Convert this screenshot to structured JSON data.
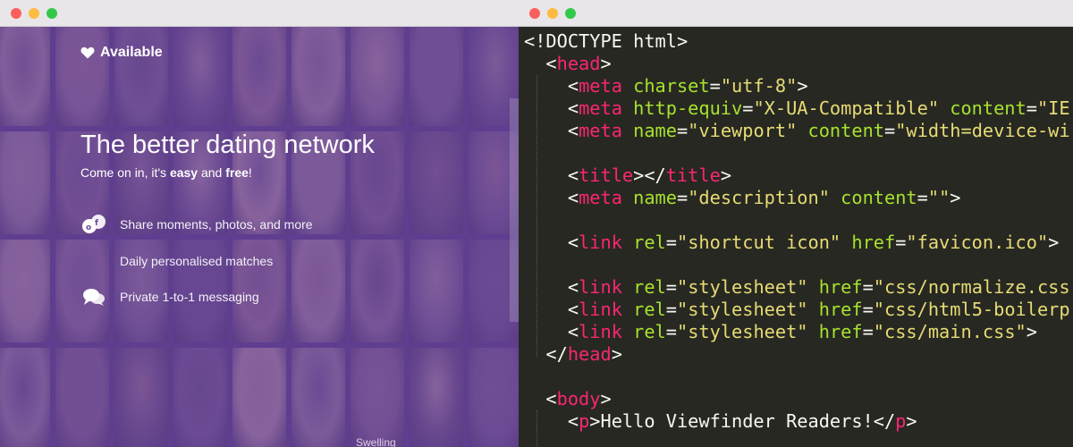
{
  "left_window": {
    "site": {
      "logo_text": "Available",
      "headline": "The better dating network",
      "tagline": {
        "part1": "Come on in, it's ",
        "easy": "easy",
        "and": " and ",
        "free": "free",
        "end": "!"
      },
      "features": [
        {
          "icon": "share-icon",
          "text": "Share moments, photos, and more"
        },
        {
          "icon": "",
          "text": "Daily personalised matches"
        },
        {
          "icon": "chat-icon",
          "text": "Private 1-to-1 messaging"
        }
      ],
      "bottom_text": "Swelling"
    },
    "overlay_color": "#623e96"
  },
  "right_window": {
    "code_lines": [
      [
        [
          "punc",
          "<!DOCTYPE html>"
        ]
      ],
      [
        [
          "punc",
          "  <"
        ],
        [
          "tag",
          "head"
        ],
        [
          "punc",
          ">"
        ]
      ],
      [
        [
          "punc",
          "    <"
        ],
        [
          "tag",
          "meta"
        ],
        [
          "punc",
          " "
        ],
        [
          "attr",
          "charset"
        ],
        [
          "punc",
          "="
        ],
        [
          "str",
          "\"utf-8\""
        ],
        [
          "punc",
          ">"
        ]
      ],
      [
        [
          "punc",
          "    <"
        ],
        [
          "tag",
          "meta"
        ],
        [
          "punc",
          " "
        ],
        [
          "attr",
          "http-equiv"
        ],
        [
          "punc",
          "="
        ],
        [
          "str",
          "\"X-UA-Compatible\""
        ],
        [
          "punc",
          " "
        ],
        [
          "attr",
          "content"
        ],
        [
          "punc",
          "="
        ],
        [
          "str",
          "\"IE"
        ]
      ],
      [
        [
          "punc",
          "    <"
        ],
        [
          "tag",
          "meta"
        ],
        [
          "punc",
          " "
        ],
        [
          "attr",
          "name"
        ],
        [
          "punc",
          "="
        ],
        [
          "str",
          "\"viewport\""
        ],
        [
          "punc",
          " "
        ],
        [
          "attr",
          "content"
        ],
        [
          "punc",
          "="
        ],
        [
          "str",
          "\"width=device-wi"
        ]
      ],
      [],
      [
        [
          "punc",
          "    <"
        ],
        [
          "tag",
          "title"
        ],
        [
          "punc",
          "></"
        ],
        [
          "tag",
          "title"
        ],
        [
          "punc",
          ">"
        ]
      ],
      [
        [
          "punc",
          "    <"
        ],
        [
          "tag",
          "meta"
        ],
        [
          "punc",
          " "
        ],
        [
          "attr",
          "name"
        ],
        [
          "punc",
          "="
        ],
        [
          "str",
          "\"description\""
        ],
        [
          "punc",
          " "
        ],
        [
          "attr",
          "content"
        ],
        [
          "punc",
          "="
        ],
        [
          "str",
          "\"\""
        ],
        [
          "punc",
          ">"
        ]
      ],
      [],
      [
        [
          "punc",
          "    <"
        ],
        [
          "tag",
          "link"
        ],
        [
          "punc",
          " "
        ],
        [
          "attr",
          "rel"
        ],
        [
          "punc",
          "="
        ],
        [
          "str",
          "\"shortcut icon\""
        ],
        [
          "punc",
          " "
        ],
        [
          "attr",
          "href"
        ],
        [
          "punc",
          "="
        ],
        [
          "str",
          "\"favicon.ico\""
        ],
        [
          "punc",
          ">"
        ]
      ],
      [],
      [
        [
          "punc",
          "    <"
        ],
        [
          "tag",
          "link"
        ],
        [
          "punc",
          " "
        ],
        [
          "attr",
          "rel"
        ],
        [
          "punc",
          "="
        ],
        [
          "str",
          "\"stylesheet\""
        ],
        [
          "punc",
          " "
        ],
        [
          "attr",
          "href"
        ],
        [
          "punc",
          "="
        ],
        [
          "str",
          "\"css/normalize.css"
        ]
      ],
      [
        [
          "punc",
          "    <"
        ],
        [
          "tag",
          "link"
        ],
        [
          "punc",
          " "
        ],
        [
          "attr",
          "rel"
        ],
        [
          "punc",
          "="
        ],
        [
          "str",
          "\"stylesheet\""
        ],
        [
          "punc",
          " "
        ],
        [
          "attr",
          "href"
        ],
        [
          "punc",
          "="
        ],
        [
          "str",
          "\"css/html5-boilerp"
        ]
      ],
      [
        [
          "punc",
          "    <"
        ],
        [
          "tag",
          "link"
        ],
        [
          "punc",
          " "
        ],
        [
          "attr",
          "rel"
        ],
        [
          "punc",
          "="
        ],
        [
          "str",
          "\"stylesheet\""
        ],
        [
          "punc",
          " "
        ],
        [
          "attr",
          "href"
        ],
        [
          "punc",
          "="
        ],
        [
          "str",
          "\"css/main.css\""
        ],
        [
          "punc",
          ">"
        ]
      ],
      [
        [
          "punc",
          "  </"
        ],
        [
          "tag",
          "head"
        ],
        [
          "punc",
          ">"
        ]
      ],
      [],
      [
        [
          "punc",
          "  <"
        ],
        [
          "tag",
          "body"
        ],
        [
          "punc",
          ">"
        ]
      ],
      [
        [
          "punc",
          "    <"
        ],
        [
          "tag",
          "p"
        ],
        [
          "punc",
          ">Hello Viewfinder Readers!</"
        ],
        [
          "tag",
          "p"
        ],
        [
          "punc",
          ">"
        ]
      ]
    ],
    "colors": {
      "background": "#272822",
      "tag": "#f92672",
      "attribute": "#a6e22e",
      "string": "#e6db74",
      "text": "#f8f8f2"
    }
  }
}
